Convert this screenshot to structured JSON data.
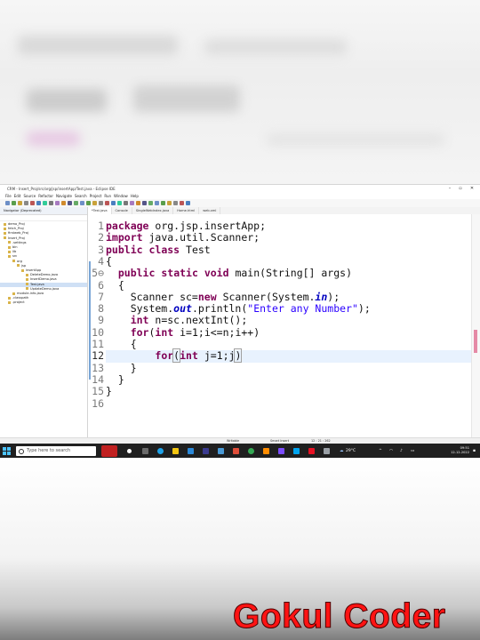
{
  "window": {
    "title": "CRM - Insert_Proj/src/org/jsp/insertApp/Test.java - Eclipse IDE"
  },
  "menu": [
    "File",
    "Edit",
    "Source",
    "Refactor",
    "Navigate",
    "Search",
    "Project",
    "Run",
    "Window",
    "Help"
  ],
  "navigator": {
    "title": "Navigator (Deprecated)",
    "tree": [
      {
        "label": "demo_Proj",
        "indent": 0
      },
      {
        "label": "fetch_Proj",
        "indent": 0
      },
      {
        "label": "firstweb_Proj",
        "indent": 0
      },
      {
        "label": "Insert_Proj",
        "indent": 0
      },
      {
        "label": ".settings",
        "indent": 1
      },
      {
        "label": "bin",
        "indent": 1
      },
      {
        "label": "lib",
        "indent": 1
      },
      {
        "label": "src",
        "indent": 1
      },
      {
        "label": "org",
        "indent": 2
      },
      {
        "label": "jsp",
        "indent": 3
      },
      {
        "label": "insertApp",
        "indent": 4
      },
      {
        "label": "DeleteDemo.java",
        "indent": 5
      },
      {
        "label": "InsertDemo.java",
        "indent": 5
      },
      {
        "label": "Test.java",
        "indent": 5
      },
      {
        "label": "UpdateDemo.java",
        "indent": 5
      },
      {
        "label": "module-info.java",
        "indent": 2
      },
      {
        "label": ".classpath",
        "indent": 1
      },
      {
        "label": ".project",
        "indent": 1
      }
    ]
  },
  "tabs": [
    "*Test.java",
    "Console",
    "SingleWebIndex.java",
    "Home.html",
    "web.xml"
  ],
  "editor": {
    "line_numbers": [
      "1",
      "2",
      "3",
      "4",
      "5⊖",
      "6",
      "7",
      "8",
      "9",
      "10",
      "11",
      "12",
      "13",
      "14",
      "15",
      "16"
    ],
    "current_line": 12
  },
  "status": {
    "writable": "Writable",
    "insert_mode": "Smart Insert",
    "position": "12 : 21 : 262"
  },
  "taskbar": {
    "search_placeholder": "Type here to search",
    "weather": "29°C",
    "time": "09:51",
    "date": "12-12-2022"
  },
  "watermark": "Gokul Coder"
}
